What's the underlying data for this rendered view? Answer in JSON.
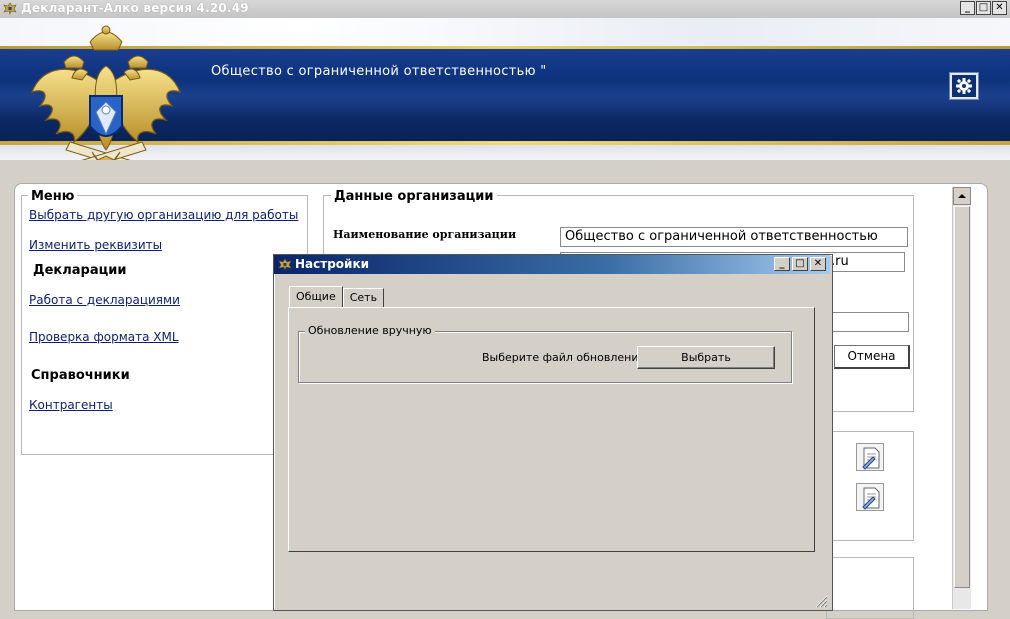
{
  "window": {
    "title": "Декларант-Алко версия 4.20.49",
    "buttons": {
      "minimize": "_",
      "maximize": "□",
      "close": "✕"
    }
  },
  "header": {
    "org_name": "Общество с ограниченной ответственностью \"",
    "settings_icon": "gear-icon"
  },
  "menu": {
    "title": "Меню",
    "links_top": [
      "Выбрать другую организацию для работы",
      "Изменить реквизиты"
    ],
    "declarations_title": "Декларации",
    "declarations_links": [
      "Работа с декларациями",
      "Проверка формата XML"
    ],
    "reference_title": "Справочники",
    "reference_links": [
      "Контрагенты"
    ]
  },
  "org_data": {
    "title": "Данные организации",
    "name_label": "Наименование организации",
    "name_value": "Общество с ограниченной ответственностью",
    "email_fragment": ".ru",
    "cancel_label": "Отмена"
  },
  "dialog": {
    "title": "Настройки",
    "tabs": [
      "Общие",
      "Сеть"
    ],
    "active_tab": "Общие",
    "group_title": "Обновление вручную",
    "choose_label": "Выберите файл обновления:",
    "choose_button": "Выбрать"
  },
  "colors": {
    "banner_blue": "#0f3582",
    "gold_stripe": "#e0c25a",
    "dialog_titlebar": "#0a246a",
    "link": "#0d1f6e"
  }
}
